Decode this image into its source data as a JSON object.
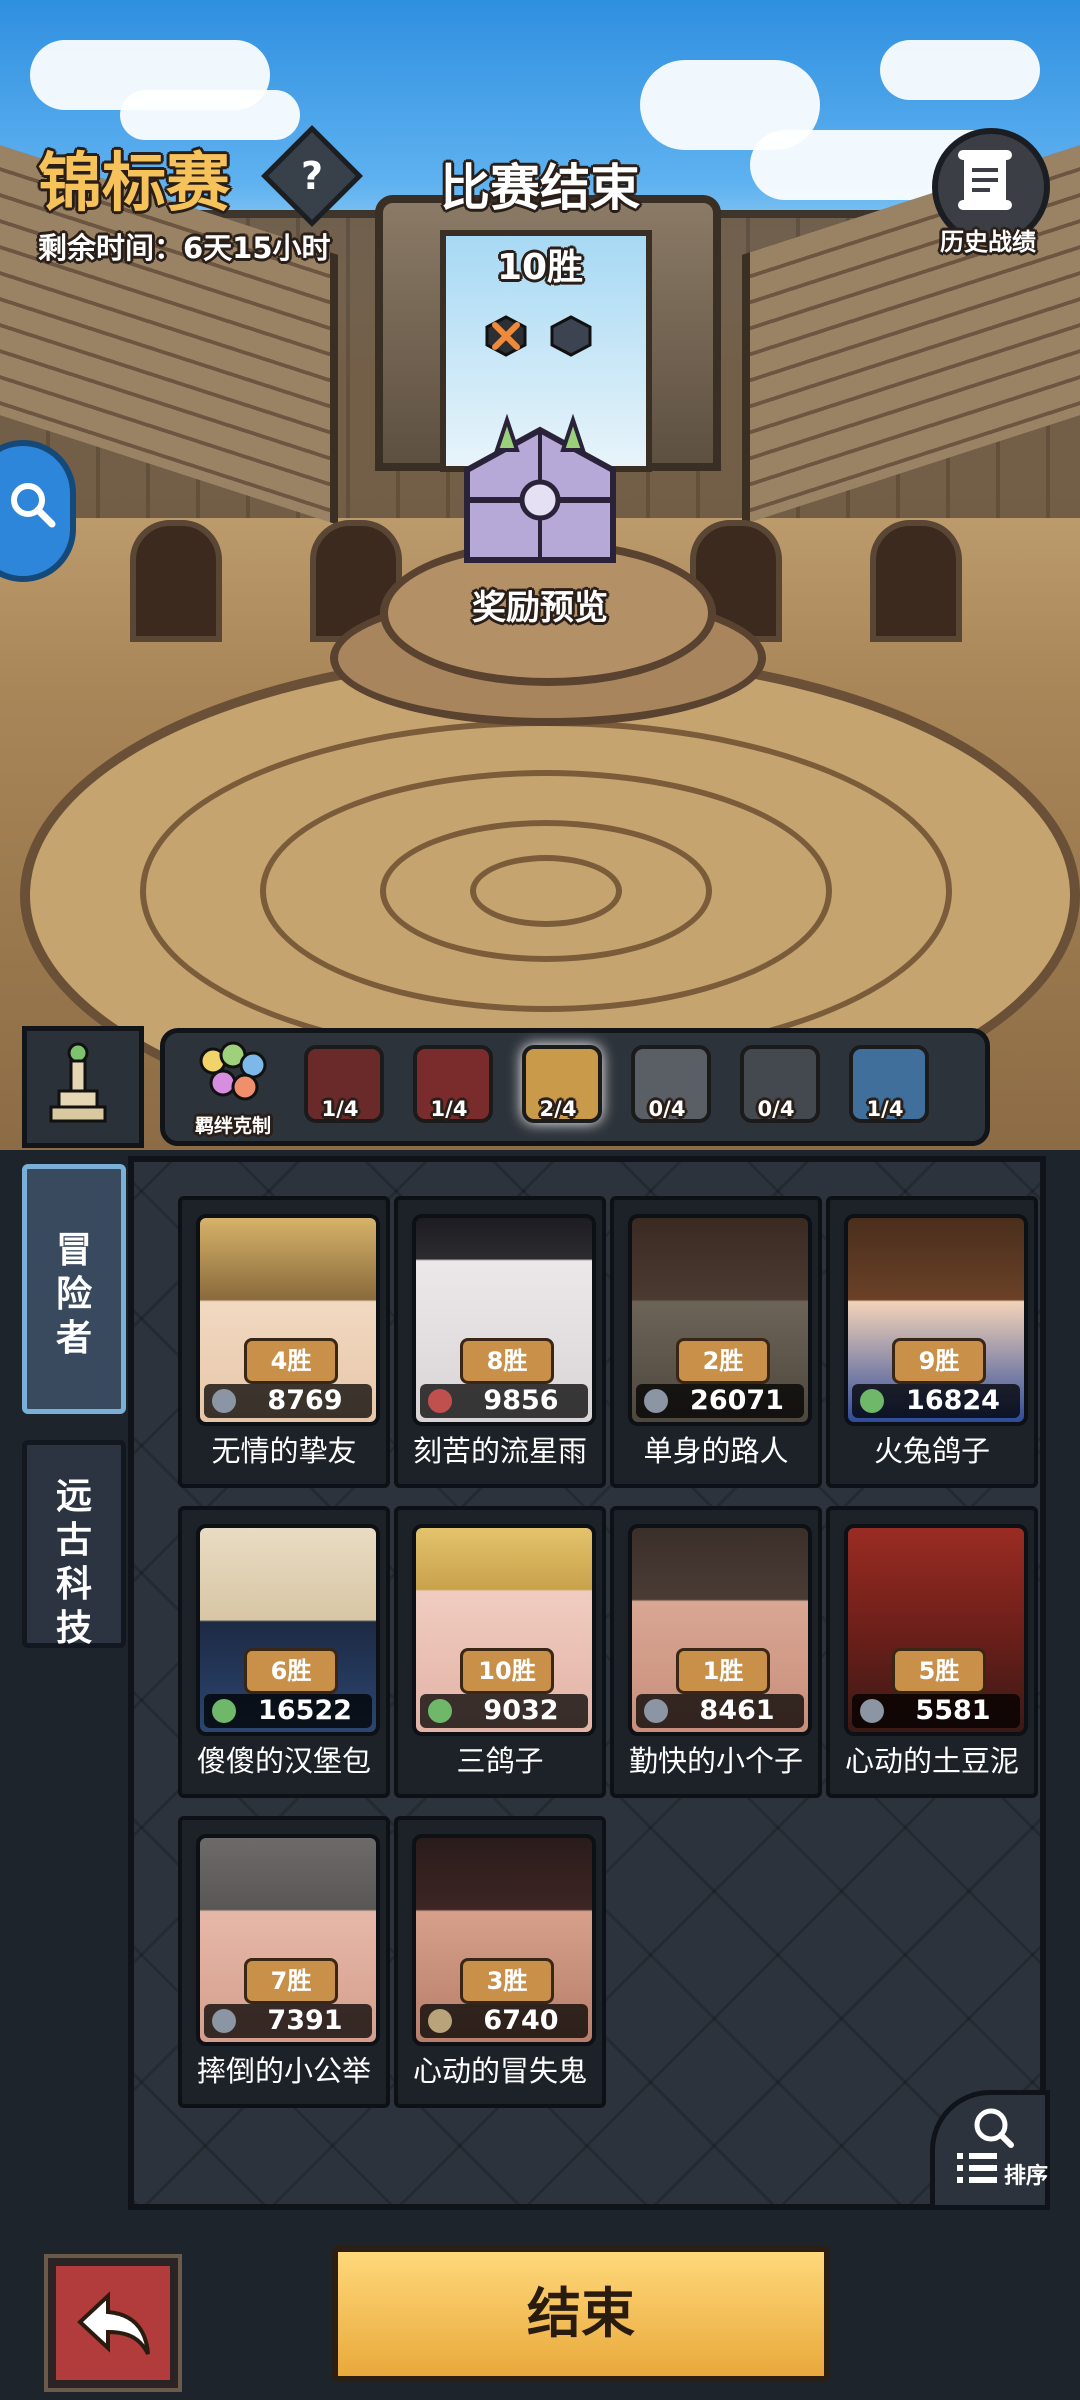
{
  "header": {
    "title": "锦标赛",
    "help_label": "?",
    "remaining_time": "剩余时间：6天15小时",
    "match_status": "比赛结束",
    "current_wins": "10胜",
    "history_label": "历史战绩",
    "reward_preview_label": "奖励预览"
  },
  "bond_bar": {
    "first_label": "羁绊克制",
    "items": [
      {
        "count": "1/4",
        "color": "#6a2a2a"
      },
      {
        "count": "1/4",
        "color": "#7a2b2b"
      },
      {
        "count": "2/4",
        "color": "#c99a4a"
      },
      {
        "count": "0/4",
        "color": "#5a5f66"
      },
      {
        "count": "0/4",
        "color": "#44494f"
      },
      {
        "count": "1/4",
        "color": "#3f6f9a"
      }
    ]
  },
  "tabs": [
    {
      "label": "冒险者"
    },
    {
      "label": "远古科技"
    }
  ],
  "cards": [
    {
      "wins": "4胜",
      "power": "8769",
      "name": "无情的挚友"
    },
    {
      "wins": "8胜",
      "power": "9856",
      "name": "刻苦的流星雨"
    },
    {
      "wins": "2胜",
      "power": "26071",
      "name": "单身的路人"
    },
    {
      "wins": "9胜",
      "power": "16824",
      "name": "火兔鸽子"
    },
    {
      "wins": "6胜",
      "power": "16522",
      "name": "傻傻的汉堡包"
    },
    {
      "wins": "10胜",
      "power": "9032",
      "name": "三鸽子"
    },
    {
      "wins": "1胜",
      "power": "8461",
      "name": "勤快的小个子"
    },
    {
      "wins": "5胜",
      "power": "5581",
      "name": "心动的土豆泥"
    },
    {
      "wins": "7胜",
      "power": "7391",
      "name": "摔倒的小公举"
    },
    {
      "wins": "3胜",
      "power": "6740",
      "name": "心动的冒失鬼"
    }
  ],
  "sort_label": "排序",
  "end_button": "结束"
}
